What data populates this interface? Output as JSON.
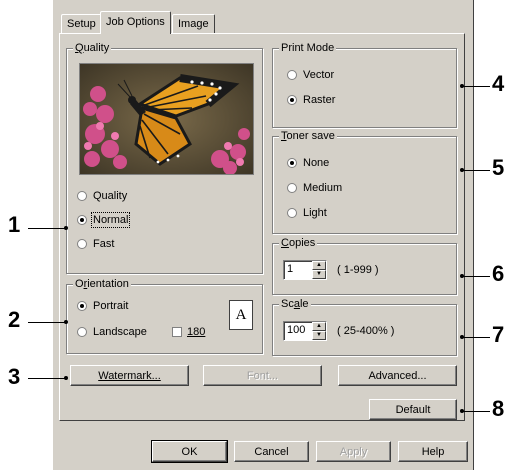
{
  "tabs": [
    {
      "label": "Setup",
      "active": false
    },
    {
      "label": "Job Options",
      "active": true
    },
    {
      "label": "Image",
      "active": false
    }
  ],
  "quality": {
    "legend": "Quality",
    "legend_mnemonic": "Q",
    "legend_rest": "uality",
    "options": [
      {
        "label": "Quality",
        "selected": false
      },
      {
        "label": "Normal",
        "selected": true
      },
      {
        "label": "Fast",
        "selected": false
      }
    ]
  },
  "orientation": {
    "legend": "Orientation",
    "legend_pre": "O",
    "legend_mnemonic": "r",
    "legend_rest": "ientation",
    "portrait": "Portrait",
    "landscape": "Landscape",
    "portrait_selected": true,
    "rotate_label": "180",
    "rotate_checked": false,
    "preview_letter": "A"
  },
  "print_mode": {
    "legend": "Print Mode",
    "options": [
      {
        "label": "Vector",
        "selected": false
      },
      {
        "label": "Raster",
        "selected": true
      }
    ]
  },
  "toner_save": {
    "legend": "Toner save",
    "legend_mnemonic": "T",
    "legend_rest": "oner save",
    "options": [
      {
        "label": "None",
        "selected": true
      },
      {
        "label": "Medium",
        "selected": false
      },
      {
        "label": "Light",
        "selected": false
      }
    ]
  },
  "copies": {
    "legend": "Copies",
    "legend_mnemonic": "C",
    "legend_rest": "opies",
    "value": "1",
    "range": "( 1-999 )"
  },
  "scale": {
    "legend": "Scale",
    "legend_pre": "Sc",
    "legend_mnemonic": "a",
    "legend_rest": "le",
    "value": "100",
    "range": "( 25-400% )"
  },
  "buttons": {
    "watermark": "Watermark...",
    "font": "Font...",
    "advanced": "Advanced...",
    "default": "Default",
    "ok": "OK",
    "cancel": "Cancel",
    "apply": "Apply",
    "help": "Help"
  },
  "callouts": [
    "1",
    "2",
    "3",
    "4",
    "5",
    "6",
    "7",
    "8"
  ],
  "colors": {
    "dialog_bg": "#d4d0c8",
    "butterfly_orange": "#e8a020",
    "flower_pink": "#d0508a"
  }
}
